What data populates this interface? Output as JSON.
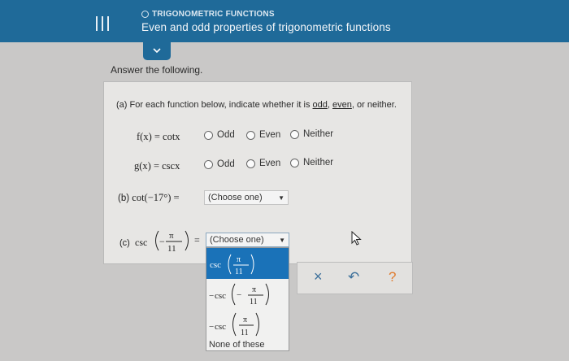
{
  "header": {
    "topic": "TRIGONOMETRIC FUNCTIONS",
    "title": "Even and odd properties of trigonometric functions",
    "expand_icon": "chevron-down-icon",
    "menu_icon": "hamburger-icon"
  },
  "answer_label": "Answer the following.",
  "part_a": {
    "prefix": "(a) For each function below, indicate whether it is",
    "odd_word": "odd",
    "even_word": "even",
    "suffix": ", or neither.",
    "rows": [
      {
        "lhs": "f(x) = cotx",
        "options": [
          "Odd",
          "Even",
          "Neither"
        ]
      },
      {
        "lhs": "g(x) = cscx",
        "options": [
          "Odd",
          "Even",
          "Neither"
        ]
      }
    ]
  },
  "part_b": {
    "label": "(b)",
    "expr": "cot(−17°) =",
    "select_value": "(Choose one)"
  },
  "part_c": {
    "label": "(c)",
    "func": "csc",
    "minus": "−",
    "numerator": "π",
    "denominator": "11",
    "equals": "=",
    "select_value": "(Choose one)",
    "options": [
      {
        "sign": "",
        "func": "csc",
        "inner_sign": "",
        "num": "π",
        "den": "11"
      },
      {
        "sign": "−",
        "func": "csc",
        "inner_sign": "−",
        "num": "π",
        "den": "11"
      },
      {
        "sign": "−",
        "func": "csc",
        "inner_sign": "",
        "num": "π",
        "den": "11"
      }
    ],
    "none_option": "None of these"
  },
  "actions": {
    "clear": "×",
    "undo": "↶",
    "help": "?"
  },
  "colors": {
    "header_bg": "#1f6a99",
    "selected_option": "#1a72b8"
  }
}
